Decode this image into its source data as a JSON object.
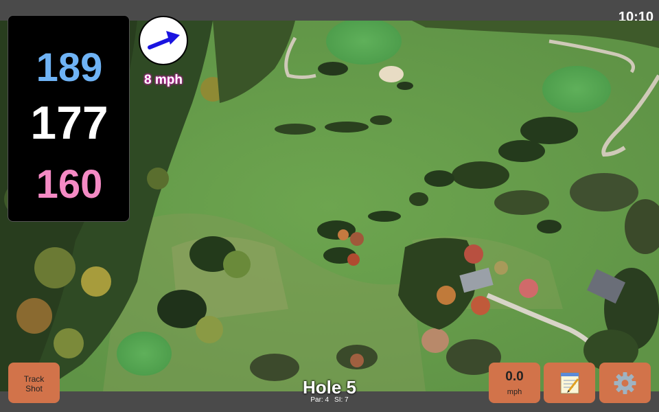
{
  "status_bar": {
    "time": "10:10"
  },
  "distances": {
    "back": "189",
    "middle": "177",
    "front": "160"
  },
  "wind": {
    "speed_label": "8 mph",
    "arrow_color": "#1a14e0"
  },
  "buttons": {
    "track_shot_label_line1": "Track",
    "track_shot_label_line2": "Shot",
    "ball_speed_value": "0.0",
    "ball_speed_unit": "mph",
    "notes_icon": "notepad-icon",
    "settings_icon": "gear-icon"
  },
  "hole": {
    "title": "Hole 5",
    "par_label": "Par: 4",
    "si_label": "SI: 7"
  },
  "colors": {
    "button_bg": "#d2734a",
    "back_distance": "#6fb3f5",
    "middle_distance": "#ffffff",
    "front_distance": "#f48ac4"
  }
}
